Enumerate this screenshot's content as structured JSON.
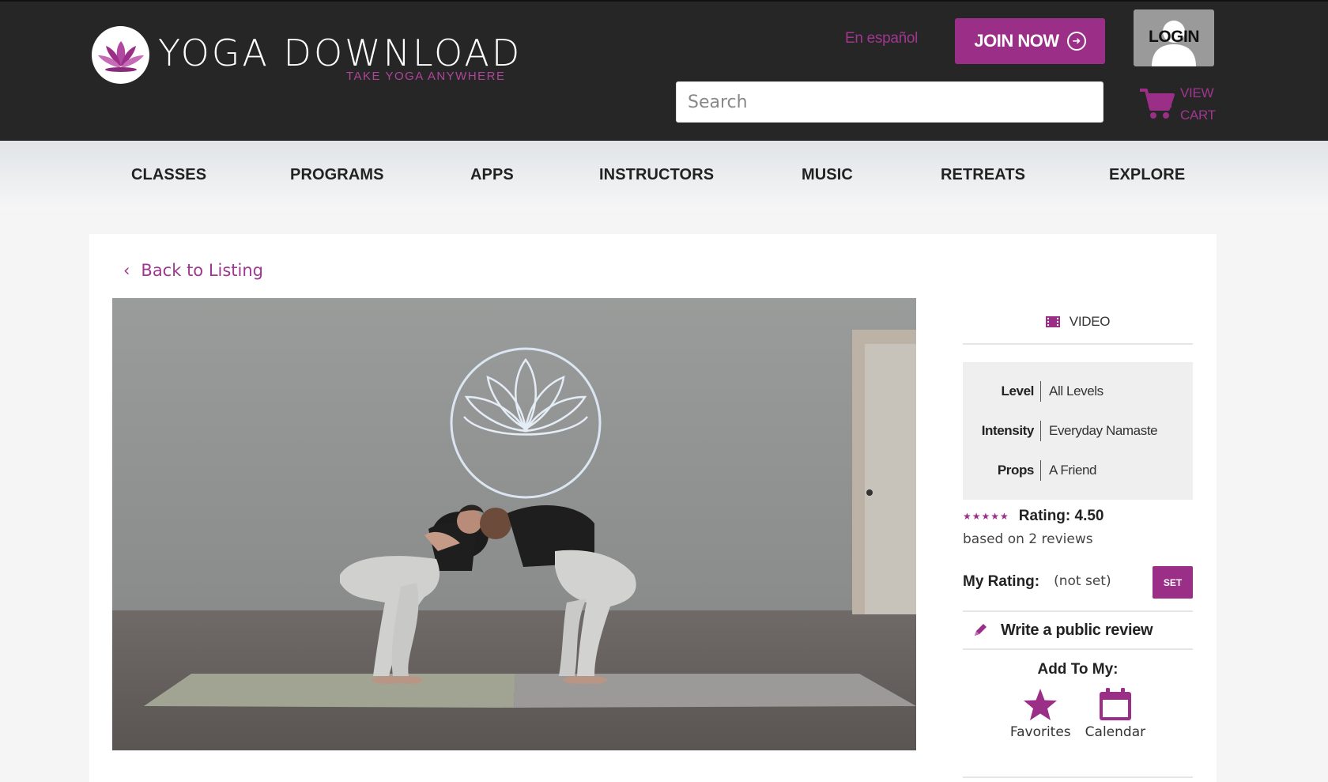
{
  "header": {
    "logo_title": "YOGA DOWNLOAD",
    "logo_tagline": "TAKE YOGA ANYWHERE",
    "language_link": "En español",
    "join_label": "JOIN NOW",
    "login_label": "LOGIN",
    "search_placeholder": "Search",
    "cart_line1": "VIEW",
    "cart_line2": "CART"
  },
  "nav": {
    "items": [
      "CLASSES",
      "PROGRAMS",
      "APPS",
      "INSTRUCTORS",
      "MUSIC",
      "RETREATS",
      "EXPLORE"
    ]
  },
  "content": {
    "back_label": "Back to Listing"
  },
  "sidebar": {
    "type_label": "VIDEO",
    "meta": [
      {
        "key": "Level",
        "value": "All Levels"
      },
      {
        "key": "Intensity",
        "value": "Everyday Namaste"
      },
      {
        "key": "Props",
        "value": "A Friend"
      }
    ],
    "stars": "★★★★★",
    "rating_value": 4.5,
    "rating_label": "Rating: 4.50",
    "reviews_text": "based on 2 reviews",
    "my_rating_label": "My Rating:",
    "my_rating_value": "(not set)",
    "set_label": "SET",
    "review_label": "Write a public review",
    "add_to_title": "Add To My:",
    "add_favorites": "Favorites",
    "add_calendar": "Calendar"
  },
  "colors": {
    "brand": "#9b2f88",
    "header_bg": "#262626"
  },
  "icons": [
    "lotus-icon",
    "arrow-circle-icon",
    "user-icon",
    "cart-icon",
    "chevron-left-icon",
    "film-icon",
    "pencil-icon",
    "star-icon",
    "calendar-icon"
  ]
}
